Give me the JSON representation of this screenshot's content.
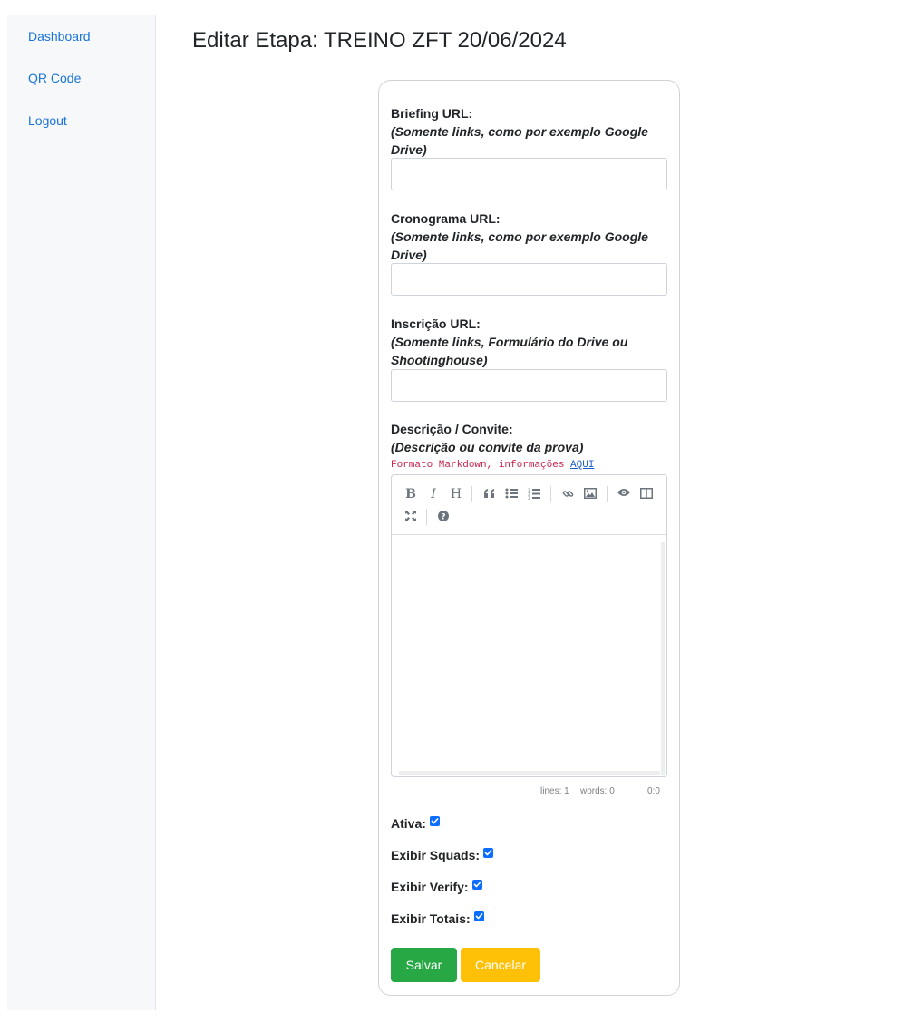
{
  "sidebar": {
    "items": [
      {
        "label": "Dashboard"
      },
      {
        "label": "QR Code"
      },
      {
        "label": "Logout"
      }
    ]
  },
  "page": {
    "title": "Editar Etapa: TREINO ZFT 20/06/2024"
  },
  "form": {
    "briefing": {
      "label": "Briefing URL:",
      "hint": "(Somente links, como por exemplo Google Drive)",
      "value": ""
    },
    "cronograma": {
      "label": "Cronograma URL:",
      "hint": "(Somente links, como por exemplo Google Drive)",
      "value": ""
    },
    "inscricao": {
      "label": "Inscrição URL:",
      "hint": "(Somente links, Formulário do Drive ou Shootinghouse)",
      "value": ""
    },
    "descricao": {
      "label": "Descrição / Convite:",
      "hint": "(Descrição ou convite da prova)",
      "format_note": "Formato Markdown, informações",
      "format_link": "AQUI"
    },
    "editor": {
      "toolbar_icons": [
        "bold-icon",
        "italic-icon",
        "heading-icon",
        "quote-icon",
        "unordered-list-icon",
        "ordered-list-icon",
        "link-icon",
        "image-icon",
        "preview-icon",
        "side-by-side-icon",
        "fullscreen-icon",
        "help-icon"
      ],
      "status": {
        "lines": "lines: 1",
        "words": "words: 0",
        "cursor": "0:0"
      }
    },
    "checkboxes": [
      {
        "label": "Ativa:",
        "checked": true
      },
      {
        "label": "Exibir Squads:",
        "checked": true
      },
      {
        "label": "Exibir Verify:",
        "checked": true
      },
      {
        "label": "Exibir Totais:",
        "checked": true
      }
    ],
    "buttons": {
      "save": "Salvar",
      "cancel": "Cancelar"
    }
  },
  "colors": {
    "link": "#1a73d9",
    "save": "#28a745",
    "cancel": "#ffc107",
    "checkbox": "#0d6efd",
    "markdown_note": "#c7254e"
  }
}
